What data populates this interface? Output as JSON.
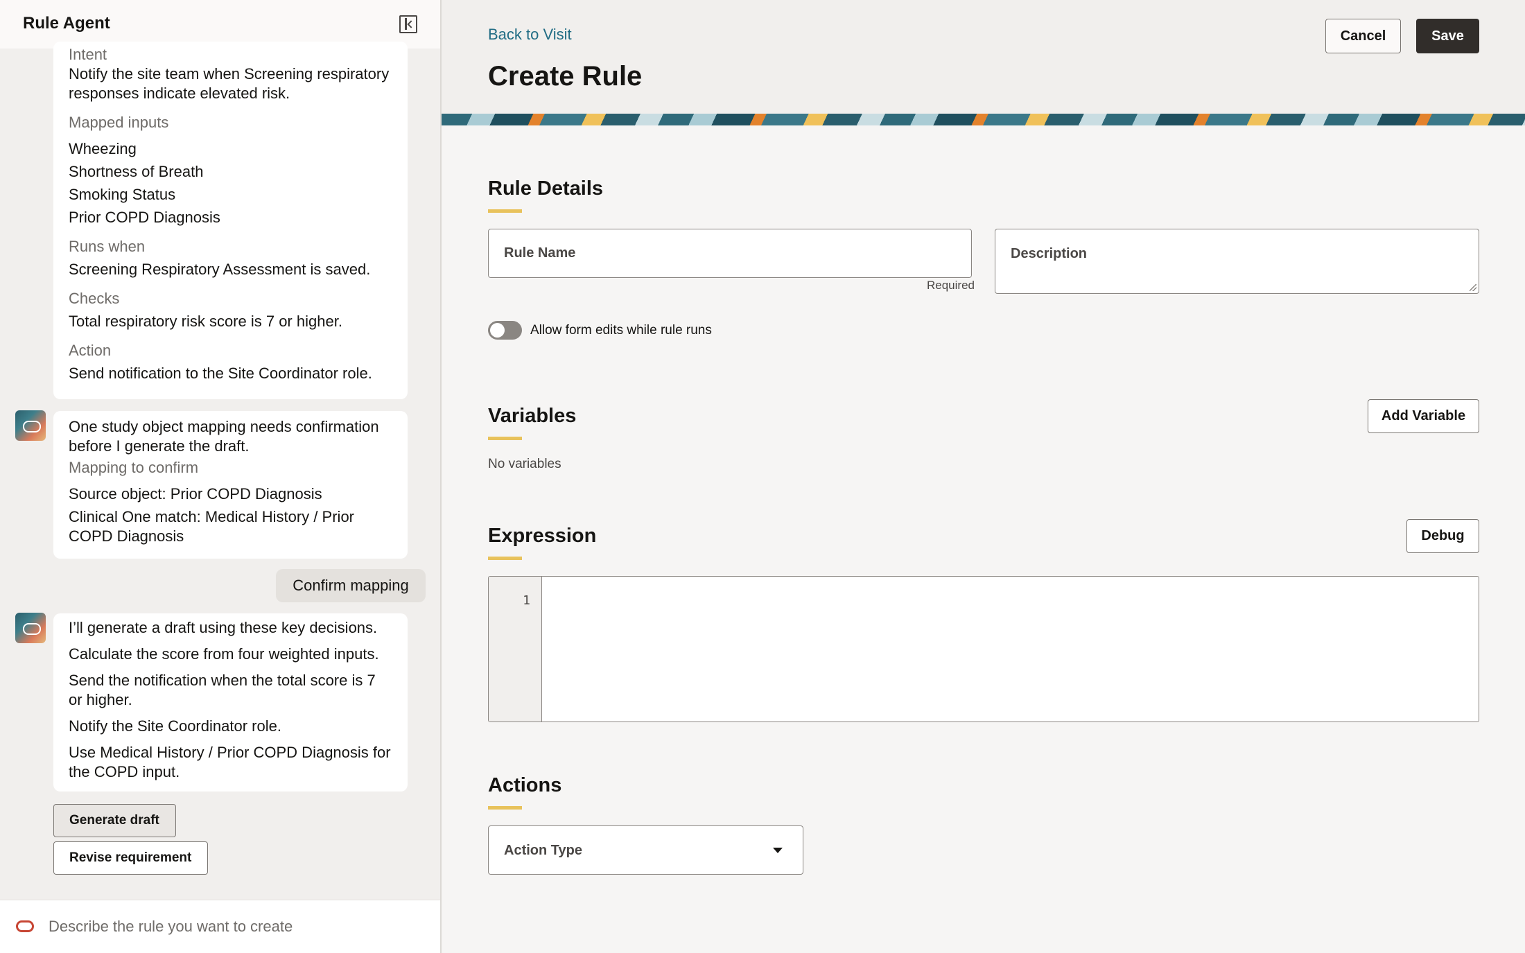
{
  "agent": {
    "title": "Rule Agent",
    "summary": {
      "intent_label": "Intent",
      "intent_text": "Notify the site team when Screening respiratory responses indicate elevated risk.",
      "mapped_inputs_label": "Mapped inputs",
      "mapped_inputs": [
        "Wheezing",
        "Shortness of Breath",
        "Smoking Status",
        "Prior COPD Diagnosis"
      ],
      "runs_when_label": "Runs when",
      "runs_when_text": "Screening Respiratory Assessment is saved.",
      "checks_label": "Checks",
      "checks_text": "Total respiratory risk score is 7 or higher.",
      "action_label": "Action",
      "action_text": "Send notification to the Site Coordinator role."
    },
    "mapping_message": {
      "text": "One study object mapping needs confirmation before I generate the draft.",
      "label": "Mapping to confirm",
      "source": "Source object: Prior COPD Diagnosis",
      "match": "Clinical One match: Medical History / Prior COPD Diagnosis"
    },
    "user_reply": "Confirm mapping",
    "decisions_message": {
      "intro": "I’ll generate a draft using these key decisions.",
      "items": [
        "Calculate the score from four weighted inputs.",
        "Send the notification when the total score is 7 or higher.",
        "Notify the Site Coordinator role.",
        "Use Medical History / Prior COPD Diagnosis for the COPD input."
      ]
    },
    "buttons": {
      "generate": "Generate draft",
      "revise": "Revise requirement"
    },
    "input_placeholder": "Describe the rule you want to create"
  },
  "main": {
    "back_link": "Back to Visit",
    "title": "Create Rule",
    "cancel": "Cancel",
    "save": "Save",
    "rule_details": {
      "title": "Rule Details",
      "rule_name_placeholder": "Rule Name",
      "required": "Required",
      "description_placeholder": "Description",
      "toggle_label": "Allow form edits while rule runs",
      "toggle_on": false
    },
    "variables": {
      "title": "Variables",
      "add_button": "Add Variable",
      "empty": "No variables"
    },
    "expression": {
      "title": "Expression",
      "debug_button": "Debug",
      "line_number": "1"
    },
    "actions": {
      "title": "Actions",
      "action_type_label": "Action Type"
    }
  },
  "colors": {
    "accent_underline": "#e8c25b",
    "link": "#216c84",
    "primary_button": "#312d2a",
    "oracle_red": "#c74634"
  }
}
